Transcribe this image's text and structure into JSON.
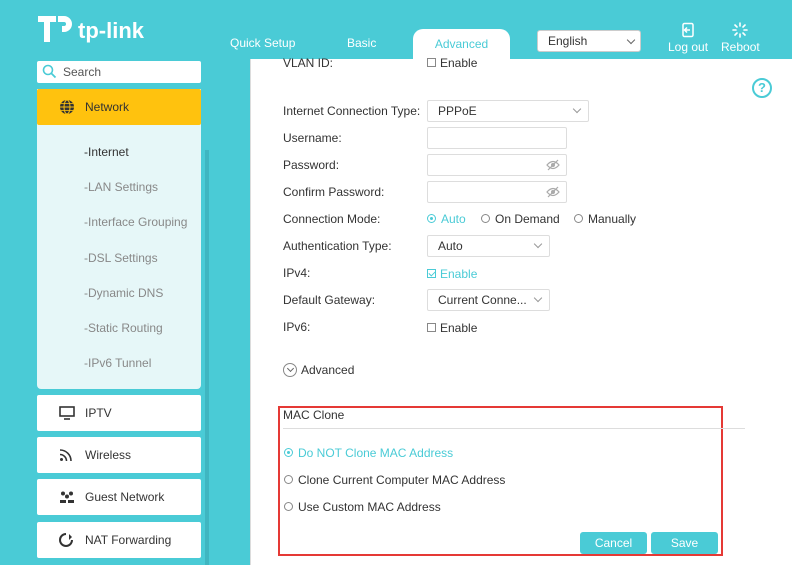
{
  "header": {
    "brand": "tp-link",
    "tabs": [
      {
        "label": "Quick Setup"
      },
      {
        "label": "Basic"
      },
      {
        "label": "Advanced"
      }
    ],
    "language": "English",
    "logout_label": "Log out",
    "reboot_label": "Reboot"
  },
  "sidebar": {
    "search_placeholder": "Search",
    "network_label": "Network",
    "network_sub": [
      {
        "label": "-Internet"
      },
      {
        "label": "-LAN Settings"
      },
      {
        "label": "-Interface Grouping"
      },
      {
        "label": "-DSL Settings"
      },
      {
        "label": "-Dynamic DNS"
      },
      {
        "label": "-Static Routing"
      },
      {
        "label": "-IPv6 Tunnel"
      }
    ],
    "items": [
      {
        "label": "IPTV",
        "icon": "tv-icon"
      },
      {
        "label": "Wireless",
        "icon": "wifi-icon"
      },
      {
        "label": "Guest Network",
        "icon": "guest-icon"
      },
      {
        "label": "NAT Forwarding",
        "icon": "nat-icon"
      }
    ]
  },
  "form": {
    "vlan_label": "VLAN ID:",
    "vlan_enable": "Enable",
    "conn_type_label": "Internet Connection Type:",
    "conn_type_value": "PPPoE",
    "username_label": "Username:",
    "password_label": "Password:",
    "confirm_password_label": "Confirm Password:",
    "conn_mode_label": "Connection Mode:",
    "conn_mode_options": [
      "Auto",
      "On Demand",
      "Manually"
    ],
    "auth_type_label": "Authentication Type:",
    "auth_type_value": "Auto",
    "ipv4_label": "IPv4:",
    "ipv4_enable": "Enable",
    "gateway_label": "Default Gateway:",
    "gateway_value": "Current Conne...",
    "ipv6_label": "IPv6:",
    "ipv6_enable": "Enable",
    "advanced_label": "Advanced"
  },
  "mac_clone": {
    "title": "MAC Clone",
    "options": [
      "Do NOT Clone MAC Address",
      "Clone Current Computer MAC Address",
      "Use Custom MAC Address"
    ],
    "cancel_label": "Cancel",
    "save_label": "Save"
  },
  "colors": {
    "accent": "#4acbd6",
    "highlight": "#ffc20e",
    "annotation": "#e53935"
  }
}
